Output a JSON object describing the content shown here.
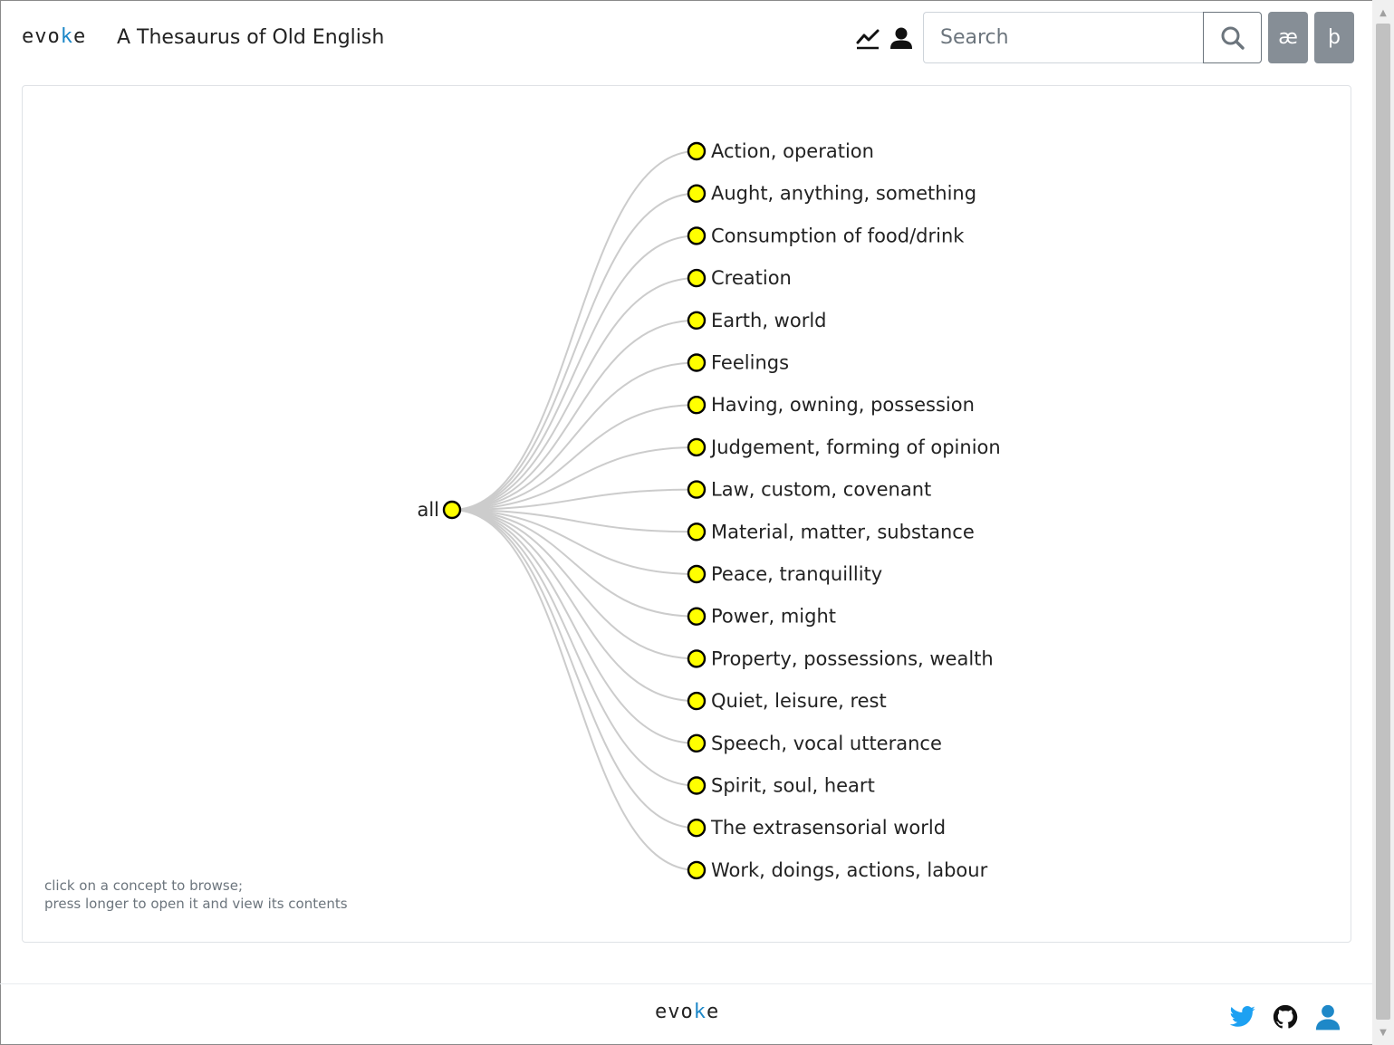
{
  "header": {
    "brand": {
      "pre": "evo",
      "tick": "k",
      "post": "e"
    },
    "title": "A Thesaurus of Old English",
    "search_placeholder": "Search",
    "char_buttons": [
      "æ",
      "þ"
    ]
  },
  "icons": {
    "stats": "line-chart-icon",
    "user": "user-icon",
    "search": "search-icon",
    "twitter": "twitter-icon",
    "github": "github-icon",
    "profile": "person-icon"
  },
  "colors": {
    "node_fill": "#ffff00",
    "node_stroke": "#000000",
    "link": "#cccccc",
    "char_button": "#868e96",
    "twitter": "#1da1f2",
    "profile": "#1e88c8"
  },
  "tree": {
    "root": "all",
    "children": [
      "Action, operation",
      "Aught, anything, something",
      "Consumption of food/drink",
      "Creation",
      "Earth, world",
      "Feelings",
      "Having, owning, possession",
      "Judgement, forming of opinion",
      "Law, custom, covenant",
      "Material, matter, substance",
      "Peace, tranquillity",
      "Power, might",
      "Property, possessions, wealth",
      "Quiet, leisure, rest",
      "Speech, vocal utterance",
      "Spirit, soul, heart",
      "The extrasensorial world",
      "Work, doings, actions, labour"
    ]
  },
  "hint": {
    "line1": "click on a concept to browse;",
    "line2": "press longer to open it and view its contents"
  },
  "footer": {
    "brand": {
      "pre": "evo",
      "tick": "k",
      "post": "e"
    }
  }
}
